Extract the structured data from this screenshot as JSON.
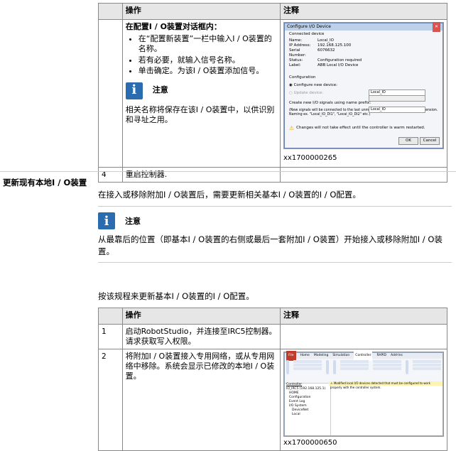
{
  "table1": {
    "col_action": "操作",
    "col_note": "注释",
    "row_cont": {
      "intro": "在配置I / O装置对话框内：",
      "bullets": [
        "在“配置新装置”一栏中输入I / O装置的名称。",
        "若有必要，就输入信号名称。",
        "单击确定。为该I / O装置添加信号。"
      ],
      "note_label": "注意",
      "note_text": "相关名称将保存在该I / O装置中，以供识别和寻址之用。",
      "caption": "xx1700000265"
    },
    "row4": {
      "num": "4",
      "action": "重启控制器."
    }
  },
  "dialog": {
    "title": "Configure I/O Device",
    "close": "✕",
    "section_connected": "Connected device",
    "fields": [
      {
        "k": "Name:",
        "v": "Local_IO"
      },
      {
        "k": "IP Address:",
        "v": "192.168.125.100"
      },
      {
        "k": "Serial Number:",
        "v": "6076632"
      },
      {
        "k": "Status:",
        "v": "Configuration required"
      },
      {
        "k": "Label:",
        "v": "ABB Local I/O Device"
      }
    ],
    "section_config": "Configuration",
    "opt_new": "Configure new device:",
    "opt_new_val": "Local_IO",
    "opt_update": "Update device:",
    "prefix_label": "Create new I/O signals using name prefix:",
    "prefix_val": "Local_IO",
    "hint": "(New signals will be connected to the last unmapped points of the device or extension. Naming ex. \"Local_IO_DI1\", \"Local_IO_DI2\" etc.)",
    "warning": "Changes will not take effect until the controller is warm restarted.",
    "ok": "OK",
    "cancel": "Cancel"
  },
  "section": {
    "title": "更新现有本地I / O装置",
    "intro": "在接入或移除附加I / O装置后，需要更新相关基本I / O装置的I / O配置。",
    "note_label": "注意",
    "note_text": "从最靠后的位置（即基本I / O装置的右侧或最后一套附加I / O装置）开始接入或移除附加I / O装置。",
    "procedure": "按该规程来更新基本I / O装置的I / O配置。"
  },
  "table2": {
    "col_action": "操作",
    "col_note": "注释",
    "rows": [
      {
        "num": "1",
        "action": "启动RobotStudio，并连接至IRC5控制器。请求获取写入权限。"
      },
      {
        "num": "2",
        "action": "将附加I / O装置接入专用网络，或从专用网络中移除。系统会显示已修改的本地I / O装置。",
        "caption": "xx1700000650"
      }
    ]
  },
  "robotstudio": {
    "tabs": [
      "File",
      "Home",
      "Modeling",
      "Simulation",
      "Controller",
      "RAPID",
      "Add-Ins"
    ],
    "tree": [
      "Controller",
      "IO_IRC5 (192.168.125.1)",
      "HOME",
      "Configuration",
      "Event Log",
      "I/O System",
      "DeviceNet",
      "Local"
    ],
    "warning": "Modified local I/O devices detected that must be configured to work properly with the controller system."
  }
}
